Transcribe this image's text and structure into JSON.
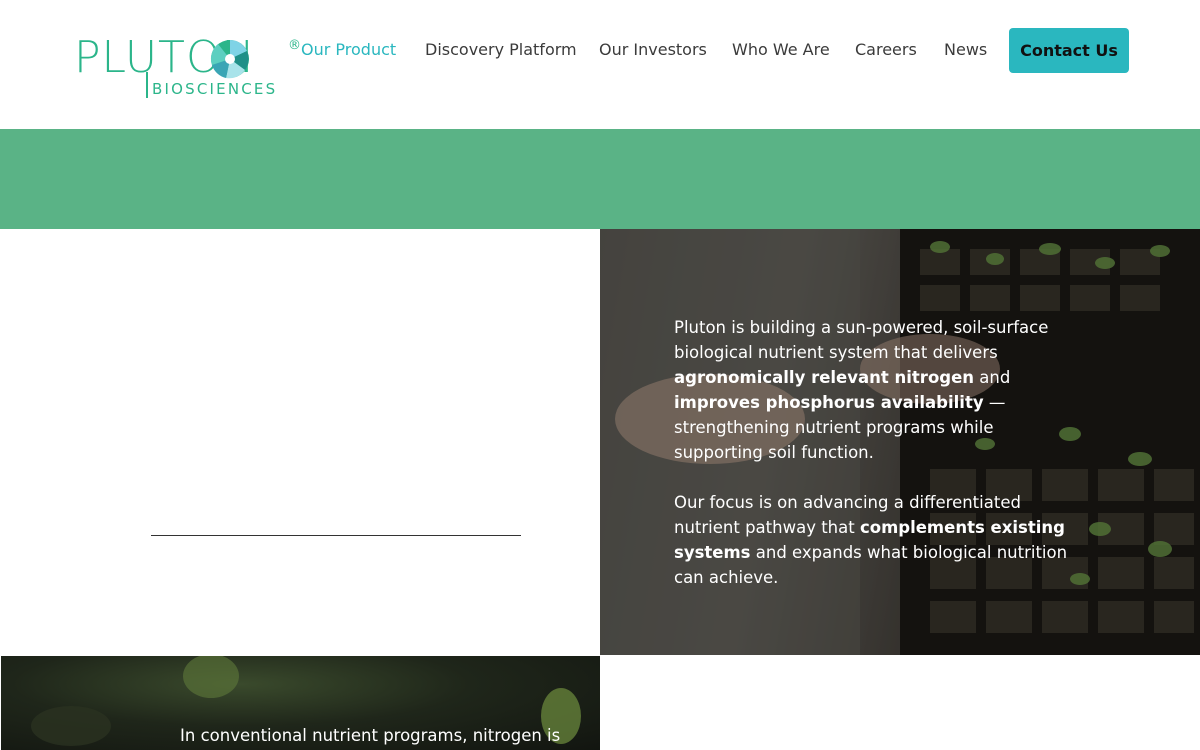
{
  "brand": {
    "wordmark": "PLUTON",
    "registered": "®",
    "subtitle": "BIOSCIENCES",
    "accent_color": "#2bb58a"
  },
  "nav": {
    "items": [
      {
        "label": "Our Product",
        "active": true
      },
      {
        "label": "Discovery Platform",
        "active": false
      },
      {
        "label": "Our Investors",
        "active": false
      },
      {
        "label": "Who We Are",
        "active": false
      },
      {
        "label": "Careers",
        "active": false
      },
      {
        "label": "News",
        "active": false
      }
    ],
    "contact_label": "Contact Us",
    "active_color": "#2ab7bf"
  },
  "band": {
    "color": "#5ab386"
  },
  "intro": {
    "paragraph1": {
      "t1": "Pluton is building a sun-powered, soil-surface biological nutrient system that delivers ",
      "b1": "agronomically relevant nitrogen",
      "t2": " and ",
      "b2": "improves phosphorus availability",
      "t3": " — strengthening nutrient programs while supporting soil function."
    },
    "paragraph2": {
      "t1": "Our focus is on advancing a differentiated nutrient pathway that ",
      "b1": "complements existing systems",
      "t2": " and expands what biological nutrition can achieve."
    }
  },
  "bottom": {
    "text": "In conventional nutrient programs, nitrogen is"
  }
}
